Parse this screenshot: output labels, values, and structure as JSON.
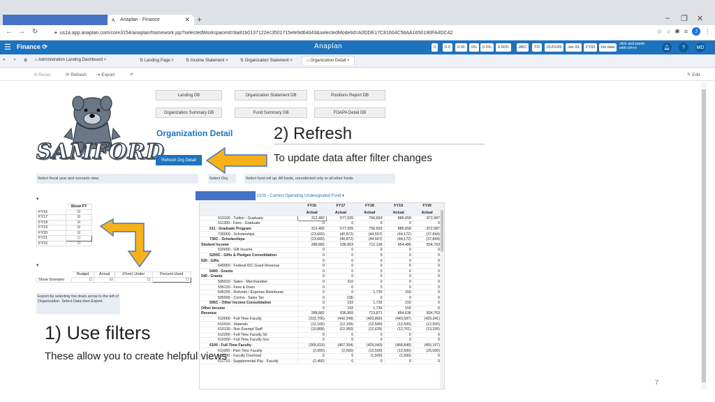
{
  "browser": {
    "tab_title": "Anaplan - Finance",
    "new_tab": "+",
    "url": "us1a.app.anaplan.com/core3154/anaplan/framework.jsp?selectedWorkspaceId=8a81b0137122ec3501715efe9d64043&selectedModelId=A0DDE17C81604C58AA1650190FA4DC42",
    "profile_initial": "J"
  },
  "anaplan": {
    "app_name": "Finance",
    "brand": "Anaplan",
    "format_buttons": [
      "0",
      "0.0",
      "0.00",
      "0%",
      "0.0%",
      "0.00%",
      "ABC",
      "T/F",
      "01/01/99",
      "Jan 99",
      "FY99",
      "No data"
    ],
    "copy_hint_1": "click and paste",
    "copy_hint_2": "with ctrl+v",
    "user_initials": "MD",
    "help": "?"
  },
  "page_tabs": [
    "Administration Landing Dashboard",
    "Landing Page",
    "Income Statement",
    "Organization Statement",
    "Organization Detail"
  ],
  "toolbar": {
    "reset": "Reset",
    "refresh": "Refresh",
    "export": "Export",
    "edit": "Edit"
  },
  "nav_buttons": {
    "landing_db": "Landing DB",
    "org_statement_db": "Organization Statement DB",
    "positions_report_db": "Positions Report DB",
    "org_summary_db": "Organization Summary DB",
    "fund_summary_db": "Fund Summary DB",
    "foapa_detail_db": "FOAPA Detail DB"
  },
  "logo_text": "SAMFORD",
  "org_title": "Organization Detail",
  "refresh_button": "Refresh Org Detail",
  "annotation_refresh": {
    "title": "2) Refresh",
    "subtitle": "To update data after filter changes"
  },
  "annotation_filters": {
    "title": "1) Use filters",
    "subtitle": "These allow you to create helpful views"
  },
  "labels": {
    "fiscal_year": "Select fiscal year and scenario view",
    "select_org": "Select Org",
    "fund_rollup": "Select fund roll up: All funds, unrestricted only or all other funds",
    "fund_selector": "1100 - Current Operating Undesignated Fund",
    "export_note": "Export by selecting the down arrow to the left of Organization. Select Data then Export."
  },
  "fy_filter": {
    "header": "Show FY",
    "rows": [
      {
        "label": "FY16",
        "checked": true
      },
      {
        "label": "FY17",
        "checked": true
      },
      {
        "label": "FY18",
        "checked": true
      },
      {
        "label": "FY19",
        "checked": true
      },
      {
        "label": "FY20",
        "checked": true
      },
      {
        "label": "FY21",
        "checked": false
      },
      {
        "label": "FY22",
        "checked": false
      }
    ]
  },
  "scenario_filter": {
    "headers": [
      "Budget",
      "Actual",
      "(Over) Under",
      "Percent Used"
    ],
    "row_label": "Show Scenario",
    "checked": [
      false,
      true,
      false,
      false
    ]
  },
  "data_table": {
    "years": [
      "FY16",
      "FY17",
      "FY18",
      "FY19",
      "FY20"
    ],
    "scenario": "Actual",
    "rows": [
      {
        "label": "510100 - Tuition - Graduate",
        "indent": 2,
        "values": [
          "312,482",
          "577,535",
          "756,693",
          "886,658",
          "872,987"
        ]
      },
      {
        "label": "511300 - Fees - Graduate",
        "indent": 2,
        "values": [
          "0",
          "0",
          "0",
          "0",
          "0"
        ]
      },
      {
        "label": "511 - Graduate Program",
        "indent": 1,
        "bold": true,
        "values": [
          "312,482",
          "577,535",
          "756,693",
          "886,658",
          "872,987"
        ]
      },
      {
        "label": "730000 - Scholarships",
        "indent": 2,
        "values": [
          "(23,600)",
          "(40,872)",
          "(44,557)",
          "(44,172)",
          "(37,844)"
        ]
      },
      {
        "label": "730C - Scholarships",
        "indent": 1,
        "bold": true,
        "values": [
          "(23,600)",
          "(40,872)",
          "(44,557)",
          "(44,172)",
          "(37,844)"
        ]
      },
      {
        "label": "Student Income",
        "indent": 0,
        "bold": true,
        "values": [
          "288,882",
          "536,663",
          "712,136",
          "854,486",
          "834,763"
        ]
      },
      {
        "label": "520000 - Gift Income",
        "indent": 2,
        "values": [
          "0",
          "0",
          "0",
          "0",
          "0"
        ]
      },
      {
        "label": "5200C - Gifts & Pledges Consolidation",
        "indent": 1,
        "bold": true,
        "values": [
          "0",
          "0",
          "0",
          "0",
          "0"
        ]
      },
      {
        "label": "520 - Gifts",
        "indent": 0,
        "bold": true,
        "values": [
          "0",
          "0",
          "0",
          "0",
          "0"
        ]
      },
      {
        "label": "540050 - Federal IDC Grant Revenue",
        "indent": 2,
        "values": [
          "0",
          "0",
          "0",
          "0",
          "0"
        ]
      },
      {
        "label": "5400 - Grants",
        "indent": 1,
        "bold": true,
        "values": [
          "0",
          "0",
          "0",
          "0",
          "0"
        ]
      },
      {
        "label": "540 - Grants",
        "indent": 0,
        "bold": true,
        "values": [
          "0",
          "0",
          "0",
          "0",
          "0"
        ]
      },
      {
        "label": "595010 - Sales - Merchandise",
        "indent": 2,
        "values": [
          "0",
          "210",
          "0",
          "0",
          "0"
        ]
      },
      {
        "label": "595120 - Fees & Dues",
        "indent": 2,
        "values": [
          "0",
          "0",
          "0",
          "0",
          "0"
        ]
      },
      {
        "label": "595255 - Refunds / Expense Reimburse",
        "indent": 2,
        "values": [
          "0",
          "0",
          "1,735",
          "150",
          "0"
        ]
      },
      {
        "label": "595999 - Contra - Sales Tax",
        "indent": 2,
        "values": [
          "0",
          "(18)",
          "0",
          "0",
          "0"
        ]
      },
      {
        "label": "595C - Other Income Consolidation",
        "indent": 1,
        "bold": true,
        "values": [
          "0",
          "192",
          "1,735",
          "150",
          "0"
        ]
      },
      {
        "label": "Other Income",
        "indent": 0,
        "bold": true,
        "values": [
          "0",
          "192",
          "1,735",
          "150",
          "0"
        ]
      },
      {
        "label": "Revenue",
        "indent": 0,
        "bold": true,
        "values": [
          "288,882",
          "536,855",
          "713,871",
          "854,636",
          "834,763"
        ]
      },
      {
        "label": "610000 - Full-Time Faculty",
        "indent": 2,
        "values": [
          "(333,706)",
          "(442,249)",
          "(403,860)",
          "(443,587)",
          "(429,341)"
        ]
      },
      {
        "label": "610010 - Stipends",
        "indent": 2,
        "values": [
          "(12,105)",
          "(12,105)",
          "(12,540)",
          "(12,500)",
          "(12,500)"
        ]
      },
      {
        "label": "610130 - Non Exempt Staff",
        "indent": 2,
        "values": [
          "(19,808)",
          "(12,950)",
          "(12,635)",
          "(12,761)",
          "(13,326)"
        ]
      },
      {
        "label": "610200 - Full-Time Faculty Sh",
        "indent": 2,
        "values": [
          "0",
          "0",
          "0",
          "0",
          "0"
        ]
      },
      {
        "label": "610300 - Full-Time Faculty Gra",
        "indent": 2,
        "values": [
          "0",
          "0",
          "0",
          "0",
          "0"
        ]
      },
      {
        "label": "6100 - Full-Time Faculty",
        "indent": 1,
        "bold": true,
        "values": [
          "(365,619)",
          "(467,304)",
          "(429,043)",
          "(468,848)",
          "(455,167)"
        ]
      },
      {
        "label": "611000 - Part-Time Faculty",
        "indent": 2,
        "values": [
          "(2,000)",
          "(2,000)",
          "(15,500)",
          "(12,500)",
          "(25,000)"
        ]
      },
      {
        "label": "611200 - Faculty Overload",
        "indent": 2,
        "values": [
          "0",
          "0",
          "(1,500)",
          "(1,500)",
          "0"
        ]
      },
      {
        "label": "611710 - Supplemental Pay - Faculty",
        "indent": 2,
        "values": [
          "(2,400)",
          "0",
          "0",
          "0",
          "0"
        ]
      }
    ]
  },
  "slide_number": "7",
  "colors": {
    "anaplan_blue": "#1e73be",
    "arrow_yellow": "#f5b21a",
    "placeholder_blue": "#4472c4"
  }
}
